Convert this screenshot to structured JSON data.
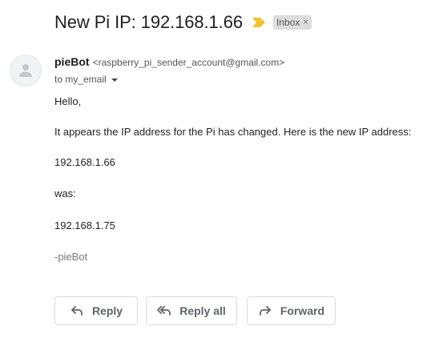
{
  "subject": "New Pi IP: 192.168.1.66",
  "label": {
    "name": "Inbox",
    "remove_glyph": "×"
  },
  "importance_color": "#f2c230",
  "sender": {
    "name": "pieBot",
    "email": "<raspberry_pi_sender_account@gmail.com>"
  },
  "recipient": "to my_email",
  "body": {
    "greeting": "Hello,",
    "paragraph": "It appears the IP address for the Pi has changed. Here is the new IP address:",
    "new_ip": "192.168.1.66",
    "was_label": "was:",
    "old_ip": "192.168.1.75",
    "signature": "-pieBot"
  },
  "actions": {
    "reply": "Reply",
    "reply_all": "Reply all",
    "forward": "Forward"
  },
  "icons": {
    "importance": "importance-marker-icon",
    "avatar": "person-icon",
    "reply": "reply-arrow-icon",
    "reply_all": "reply-all-arrow-icon",
    "forward": "forward-arrow-icon",
    "recipient_details": "chevron-down-icon"
  }
}
